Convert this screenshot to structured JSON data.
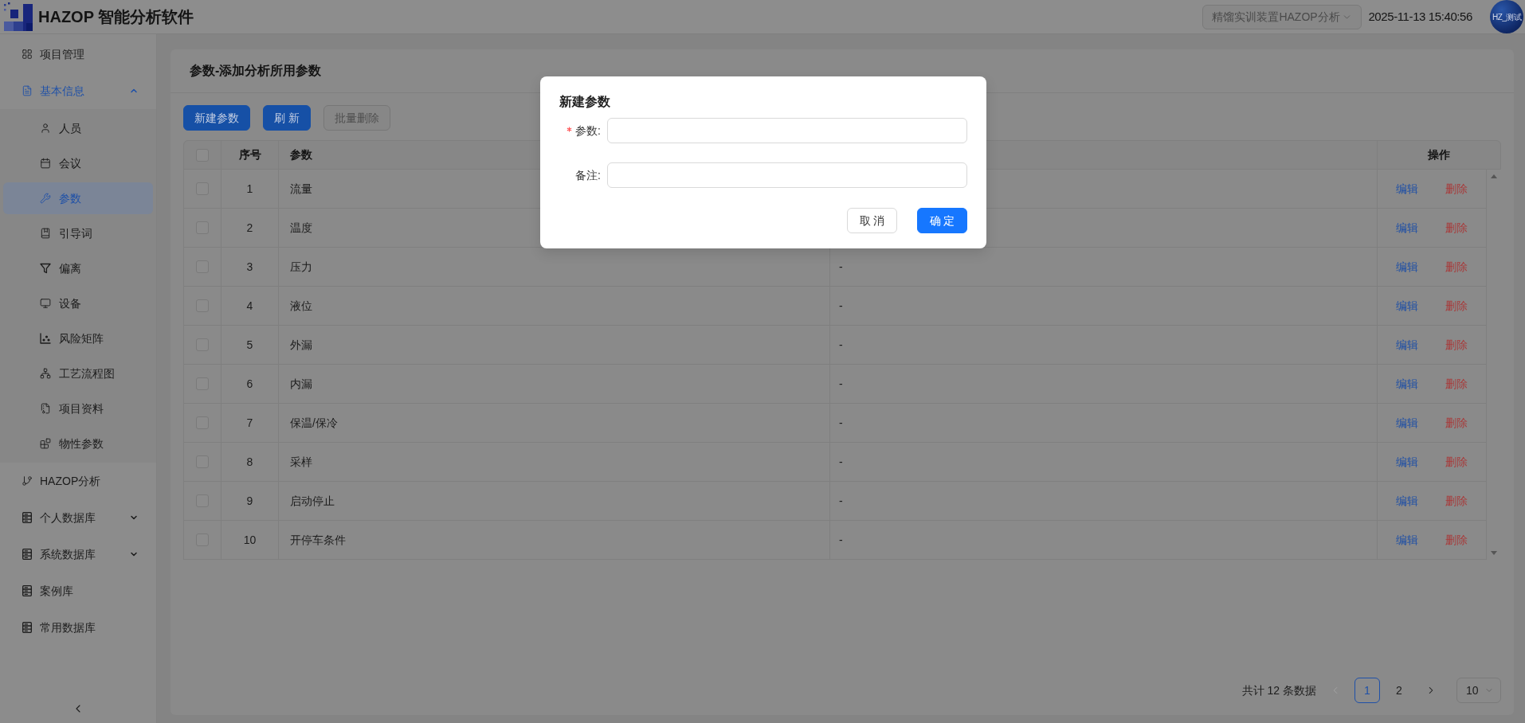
{
  "header": {
    "app_title": "HAZOP 智能分析软件",
    "project_select": {
      "value": "精馏实训装置HAZOP分析",
      "disabled": true
    },
    "datetime": "2025-11-13 15:40:56",
    "avatar": "HZ_测试"
  },
  "sidebar": {
    "items": [
      {
        "label": "项目管理",
        "selected": false
      },
      {
        "label": "基本信息",
        "selected": true,
        "expanded": true,
        "children": [
          {
            "label": "人员",
            "selected": false
          },
          {
            "label": "会议",
            "selected": false
          },
          {
            "label": "参数",
            "selected": true
          },
          {
            "label": "引导词",
            "selected": false
          },
          {
            "label": "偏离",
            "selected": false
          },
          {
            "label": "设备",
            "selected": false
          },
          {
            "label": "风险矩阵",
            "selected": false
          },
          {
            "label": "工艺流程图",
            "selected": false
          },
          {
            "label": "项目资料",
            "selected": false
          },
          {
            "label": "物性参数",
            "selected": false
          }
        ]
      },
      {
        "label": "HAZOP分析",
        "selected": false
      },
      {
        "label": "个人数据库",
        "selected": false,
        "expanded": false
      },
      {
        "label": "系统数据库",
        "selected": false,
        "expanded": false
      },
      {
        "label": "案例库",
        "selected": false
      },
      {
        "label": "常用数据库",
        "selected": false
      }
    ]
  },
  "card": {
    "title": "参数-添加分析所用参数",
    "toolbar": [
      {
        "label": "新建参数",
        "disabled": false
      },
      {
        "label": "刷 新",
        "disabled": false
      },
      {
        "label": "批量删除",
        "disabled": true
      }
    ],
    "table": {
      "header_checkbox": {
        "checked": false
      },
      "columns": {
        "no": "序号",
        "name": "参数",
        "actions": "操作"
      },
      "rows": [
        {
          "checked": false,
          "no": "1",
          "name": "流量",
          "actions": [
            {
              "label": "编辑",
              "kind": "edit"
            },
            {
              "label": "删除",
              "kind": "delete"
            }
          ]
        },
        {
          "checked": false,
          "no": "2",
          "name": "温度",
          "actions": [
            {
              "label": "编辑",
              "kind": "edit"
            },
            {
              "label": "删除",
              "kind": "delete"
            }
          ]
        },
        {
          "checked": false,
          "no": "3",
          "name": "压力",
          "remark": "-",
          "actions": [
            {
              "label": "编辑",
              "kind": "edit"
            },
            {
              "label": "删除",
              "kind": "delete"
            }
          ]
        },
        {
          "checked": false,
          "no": "4",
          "name": "液位",
          "remark": "-",
          "actions": [
            {
              "label": "编辑",
              "kind": "edit"
            },
            {
              "label": "删除",
              "kind": "delete"
            }
          ]
        },
        {
          "checked": false,
          "no": "5",
          "name": "外漏",
          "remark": "-",
          "actions": [
            {
              "label": "编辑",
              "kind": "edit"
            },
            {
              "label": "删除",
              "kind": "delete"
            }
          ]
        },
        {
          "checked": false,
          "no": "6",
          "name": "内漏",
          "remark": "-",
          "actions": [
            {
              "label": "编辑",
              "kind": "edit"
            },
            {
              "label": "删除",
              "kind": "delete"
            }
          ]
        },
        {
          "checked": false,
          "no": "7",
          "name": "保温/保冷",
          "remark": "-",
          "actions": [
            {
              "label": "编辑",
              "kind": "edit"
            },
            {
              "label": "删除",
              "kind": "delete"
            }
          ]
        },
        {
          "checked": false,
          "no": "8",
          "name": "采样",
          "remark": "-",
          "actions": [
            {
              "label": "编辑",
              "kind": "edit"
            },
            {
              "label": "删除",
              "kind": "delete"
            }
          ]
        },
        {
          "checked": false,
          "no": "9",
          "name": "启动停止",
          "remark": "-",
          "actions": [
            {
              "label": "编辑",
              "kind": "edit"
            },
            {
              "label": "删除",
              "kind": "delete"
            }
          ]
        },
        {
          "checked": false,
          "no": "10",
          "name": "开停车条件",
          "remark": "-",
          "actions": [
            {
              "label": "编辑",
              "kind": "edit"
            },
            {
              "label": "删除",
              "kind": "delete"
            }
          ]
        }
      ]
    },
    "pagination": {
      "total": "共计 12 条数据",
      "prev_disabled": true,
      "next_disabled": false,
      "pages": [
        {
          "label": "1",
          "selected": true
        },
        {
          "label": "2",
          "selected": false
        }
      ],
      "page_size": "10"
    }
  },
  "dialog": {
    "title": "新建参数",
    "fields": [
      {
        "label": "参数:",
        "required": true
      },
      {
        "label": "备注:",
        "required": false
      }
    ],
    "buttons": [
      {
        "label": "取 消",
        "kind": "default"
      },
      {
        "label": "确 定",
        "kind": "primary"
      }
    ]
  }
}
